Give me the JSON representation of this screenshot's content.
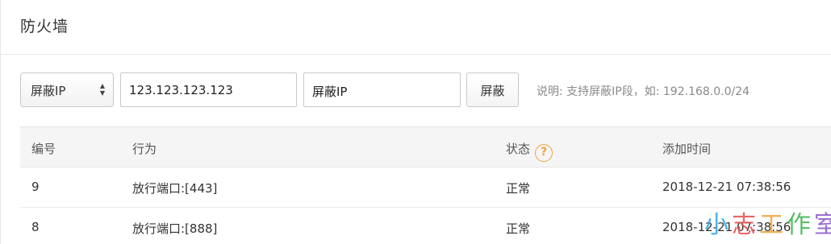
{
  "panel": {
    "title": "防火墙"
  },
  "toolbar": {
    "select_value": "屏蔽IP",
    "ip_value": "123.123.123.123",
    "action_value": "屏蔽IP",
    "submit_label": "屏蔽",
    "help": "说明: 支持屏蔽IP段，如: 192.168.0.0/24"
  },
  "table": {
    "columns": [
      "编号",
      "行为",
      "状态",
      "添加时间"
    ],
    "status_help_glyph": "?",
    "rows": [
      {
        "id": "9",
        "action": "放行端口:[443]",
        "status": "正常",
        "time": "2018-12-21 07:38:56"
      },
      {
        "id": "8",
        "action": "放行端口:[888]",
        "status": "正常",
        "time": "2018-12-21 07:38:56"
      }
    ]
  },
  "watermark": {
    "chars": [
      "小",
      "志",
      "工",
      "作",
      "室"
    ],
    "colors": [
      "#2aa6e8",
      "#e64b4b",
      "#f2a43a",
      "#3bb34a",
      "#8a55c9"
    ]
  }
}
